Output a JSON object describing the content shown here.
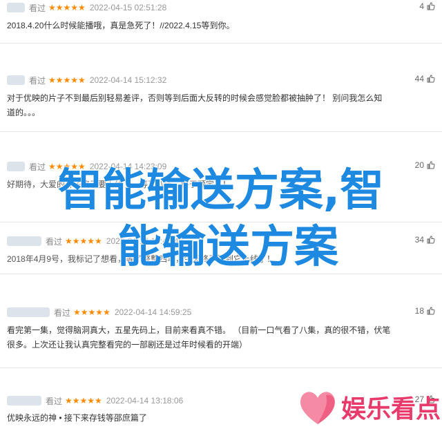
{
  "comments": [
    {
      "rating_word": "看过",
      "stars": "★★★★★",
      "time": "2022-04-15 02:51:28",
      "likes": "4",
      "lines": [
        "2018.4.20什么时候能播哦，真是急死了！//2022.4.15等到你。"
      ]
    },
    {
      "rating_word": "看过",
      "stars": "★★★★★",
      "time": "2022-04-14 15:12:32",
      "likes": "44",
      "lines": [
        "对于优映的片子不到最后别轻易差评，否则等到后面大反转的时候会感觉脸都被抽肿了！ 别问我怎么知",
        "道的。。。"
      ]
    },
    {
      "rating_word": "看过",
      "stars": "★★★★★",
      "time": "2022-04-14 14:23:09",
      "likes": "20",
      "lines": [
        "好期待，大爱的片子终于要上线了，等了八年，终于预定了！"
      ]
    },
    {
      "rating_word": "看过",
      "stars": "★★★★★",
      "time": "2022-04-14 14:44:40",
      "likes": "34",
      "lines": [
        "2018年4月9号，我标记了想看，等了整整四年，今天终于等到它上线了！"
      ]
    },
    {
      "rating_word": "看过",
      "stars": "★★★★★",
      "time": "2022-04-14 14:59:25",
      "likes": "18",
      "lines": [
        "看完第一集，觉得脑洞真大，五星先码上，目前来看真不错。 （目前一口气看了八集，真的很不错，伏笔",
        "很多。上次还让我认真完整看完的一部剧还是过年时候看的开端）"
      ]
    },
    {
      "rating_word": "看过",
      "stars": "★★★★★",
      "time": "2022-04-14 13:18:06",
      "likes": "27",
      "lines": [
        "优映永远的神 • 接下来存钱等邵庶篇了"
      ]
    }
  ],
  "overlay": {
    "line1": "智能输送方案,智",
    "line2": "能输送方案"
  },
  "watermark": {
    "text": "娱乐看点",
    "heart_color": "#f07a96",
    "text_color": "#e83a6b"
  },
  "colors": {
    "accent": "#1d89e0",
    "star": "#ff8a00"
  }
}
